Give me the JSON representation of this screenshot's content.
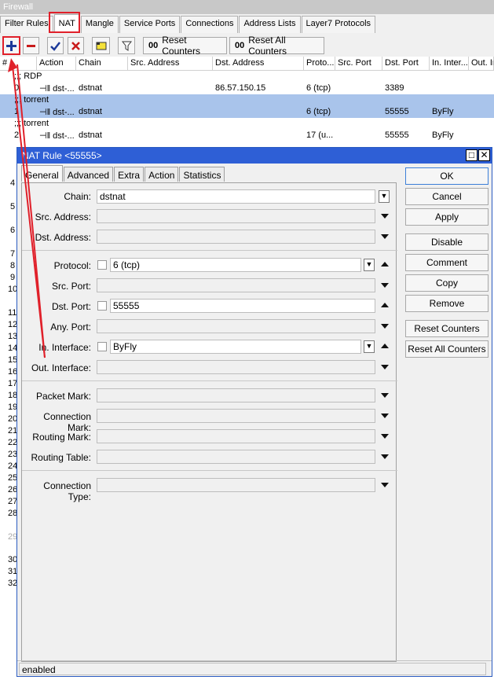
{
  "window": {
    "title": "Firewall"
  },
  "tabs": [
    "Filter Rules",
    "NAT",
    "Mangle",
    "Service Ports",
    "Connections",
    "Address Lists",
    "Layer7 Protocols"
  ],
  "toolbar": {
    "reset_counters": "Reset Counters",
    "reset_all_counters": "Reset All Counters",
    "oo": "00"
  },
  "list": {
    "columns": [
      "#",
      "Action",
      "Chain",
      "Src. Address",
      "Dst. Address",
      "Proto...",
      "Src. Port",
      "Dst. Port",
      "In. Inter...",
      "Out. In"
    ],
    "comment_rdp": ";;; RDP",
    "comment_torrent1": ";;; torrent",
    "comment_torrent2": ";;; torrent",
    "rows": [
      {
        "num": "0",
        "action": "⊣‖ dst-...",
        "chain": "dstnat",
        "dst": "86.57.150.15",
        "proto": "6 (tcp)",
        "dport": "3389",
        "inif": ""
      },
      {
        "num": "1",
        "action": "⊣‖ dst-...",
        "chain": "dstnat",
        "dst": "",
        "proto": "6 (tcp)",
        "dport": "55555",
        "inif": "ByFly"
      },
      {
        "num": "2",
        "action": "⊣‖ dst-...",
        "chain": "dstnat",
        "dst": "",
        "proto": "17 (u...",
        "dport": "55555",
        "inif": "ByFly"
      }
    ],
    "side_numbers": [
      "4",
      "5",
      "6",
      "7",
      "8",
      "9",
      "10",
      "11",
      "12",
      "13",
      "14",
      "15",
      "16",
      "17",
      "18",
      "19",
      "20",
      "21",
      "22",
      "23",
      "24",
      "25",
      "26",
      "27",
      "28",
      "29",
      "30",
      "31",
      "32"
    ]
  },
  "dialog": {
    "title": "NAT Rule <55555>",
    "tabs": [
      "General",
      "Advanced",
      "Extra",
      "Action",
      "Statistics"
    ],
    "fields": {
      "chain_label": "Chain:",
      "chain_value": "dstnat",
      "src_address_label": "Src. Address:",
      "dst_address_label": "Dst. Address:",
      "protocol_label": "Protocol:",
      "protocol_value": "6 (tcp)",
      "src_port_label": "Src. Port:",
      "dst_port_label": "Dst. Port:",
      "dst_port_value": "55555",
      "any_port_label": "Any. Port:",
      "in_interface_label": "In. Interface:",
      "in_interface_value": "ByFly",
      "out_interface_label": "Out. Interface:",
      "packet_mark_label": "Packet Mark:",
      "connection_mark_label": "Connection Mark:",
      "routing_mark_label": "Routing Mark:",
      "routing_table_label": "Routing Table:",
      "connection_type_label": "Connection Type:"
    },
    "buttons": [
      "OK",
      "Cancel",
      "Apply",
      "Disable",
      "Comment",
      "Copy",
      "Remove",
      "Reset Counters",
      "Reset All Counters"
    ],
    "status": "enabled"
  },
  "colors": {
    "accent": "#2e5fd6",
    "selected_row": "#a9c4eb",
    "highlight": "#e0202a"
  }
}
